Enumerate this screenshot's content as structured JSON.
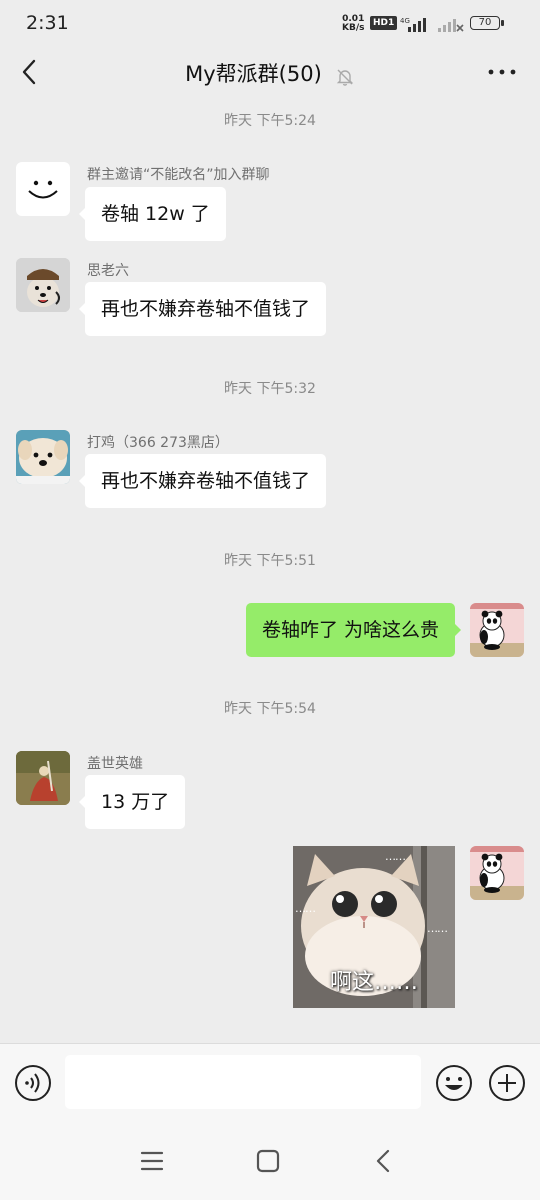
{
  "status_bar": {
    "time": "2:31",
    "net_speed_value": "0.01",
    "net_speed_unit": "KB/s",
    "hd_label": "HD1",
    "network_label": "4G",
    "battery": "70"
  },
  "header": {
    "title": "My帮派群(50)"
  },
  "messages": [
    {
      "type": "time",
      "text": "昨天 下午5:24"
    },
    {
      "type": "in",
      "sender": "群主邀请“不能改名”加入群聊",
      "text": "卷轴 12w 了",
      "avatar": "smiley-face"
    },
    {
      "type": "in",
      "sender": "思老六",
      "text": "再也不嫌弃卷轴不值钱了",
      "avatar": "dog-with-headset"
    },
    {
      "type": "time",
      "text": "昨天 下午5:32"
    },
    {
      "type": "in",
      "sender": "打鸡（366 273黑店）",
      "text": "再也不嫌弃卷轴不值钱了",
      "avatar": "fluffy-puppy"
    },
    {
      "type": "time",
      "text": "昨天 下午5:51"
    },
    {
      "type": "out",
      "text": "卷轴咋了 为啥这么贵",
      "avatar": "panda-cartoon"
    },
    {
      "type": "time",
      "text": "昨天 下午5:54"
    },
    {
      "type": "in",
      "sender": "盖世英雄",
      "text": "13 万了",
      "avatar": "painting-figure"
    },
    {
      "type": "out-sticker",
      "caption": "啊这……",
      "avatar": "panda-cartoon"
    }
  ],
  "input_bar": {
    "placeholder": ""
  },
  "colors": {
    "background": "#ededed",
    "outgoing_bubble": "#95ec69",
    "incoming_bubble": "#ffffff"
  },
  "icons": [
    "back-arrow-icon",
    "mute-bell-icon",
    "more-dots-icon",
    "voice-icon",
    "emoji-icon",
    "plus-icon",
    "menu-icon",
    "home-icon",
    "back-icon"
  ]
}
